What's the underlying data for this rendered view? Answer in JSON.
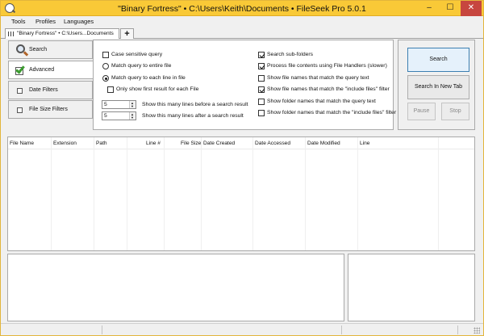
{
  "window": {
    "title": "\"Binary Fortress\" • C:\\Users\\Keith\\Documents • FileSeek Pro 5.0.1"
  },
  "menu": [
    "Tools",
    "Profiles",
    "Languages"
  ],
  "tabs": {
    "active_label": "\"Binary Fortress\" • C:\\Users...Documents",
    "add_label": "+"
  },
  "sidebar": {
    "items": [
      {
        "label": "Search",
        "icon": "magnifier-icon"
      },
      {
        "label": "Advanced",
        "icon": "checkmark-icon"
      },
      {
        "label": "Date Filters",
        "icon": "checkbox-icon"
      },
      {
        "label": "File Size Filters",
        "icon": "checkbox-icon"
      }
    ]
  },
  "options": {
    "case_sensitive": {
      "label": "Case sensitive query",
      "checked": false
    },
    "match_entire": {
      "label": "Match query to entire file",
      "selected": false
    },
    "match_each_line": {
      "label": "Match query to each line in file",
      "selected": true
    },
    "first_result_only": {
      "label": "Only show first result for each File",
      "checked": false
    },
    "lines_before": {
      "value": "5",
      "label": "Show this many lines before a search result"
    },
    "lines_after": {
      "value": "5",
      "label": "Show this many lines after a search result"
    },
    "search_subfolders": {
      "label": "Search sub-folders",
      "checked": true
    },
    "file_handlers": {
      "label": "Process file contents using File Handlers (slower)",
      "checked": true
    },
    "names_match_query": {
      "label": "Show file names that match the query text",
      "checked": false
    },
    "names_match_include": {
      "label": "Show file names that match the \"include files\" filter",
      "checked": true
    },
    "folders_match_query": {
      "label": "Show folder names that match the query text",
      "checked": false
    },
    "folders_match_include": {
      "label": "Show folder names that match the \"include files\" filter",
      "checked": false
    }
  },
  "buttons": {
    "search": "Search",
    "search_new_tab": "Search In New Tab",
    "pause": "Pause",
    "stop": "Stop"
  },
  "results": {
    "columns": [
      "File Name",
      "Extension",
      "Path",
      "Line #",
      "File Size",
      "Date Created",
      "Date Accessed",
      "Date Modified",
      "Line"
    ]
  },
  "colors": {
    "titlebar": "#f9c937",
    "close_button": "#c7463f",
    "check_green": "#3b9b2f"
  }
}
